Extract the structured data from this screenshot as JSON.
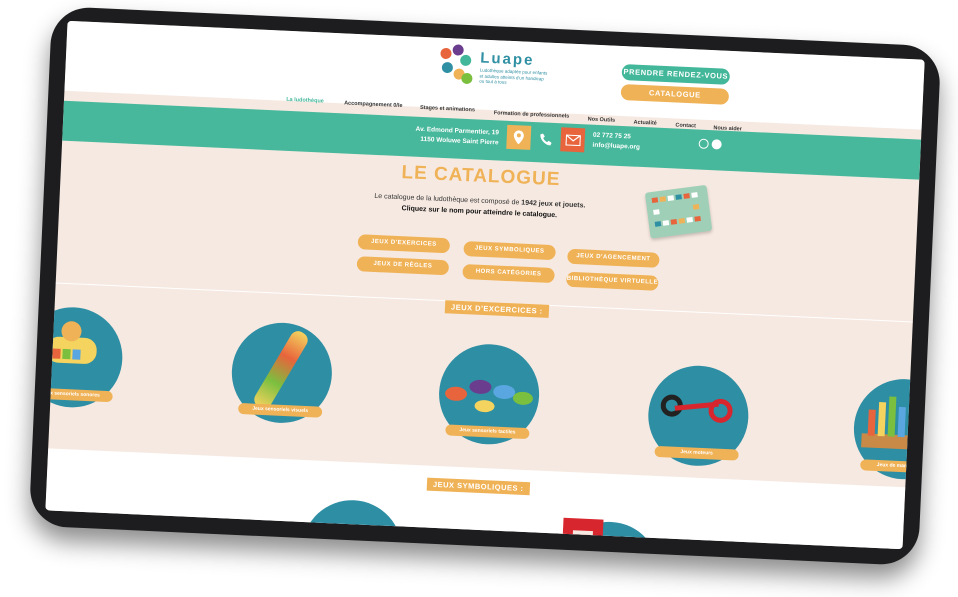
{
  "brand": {
    "name": "Luape",
    "tagline": "Ludothèque adaptée pour enfants et adultes atteints d'un handicap ou tout à tous"
  },
  "header": {
    "cta_appointment": "PRENDRE RENDEZ-VOUS",
    "cta_catalogue": "CATALOGUE"
  },
  "nav": {
    "items": [
      {
        "label": "La ludothèque",
        "active": true
      },
      {
        "label": "Accompagnement 0/le"
      },
      {
        "label": "Stages et animations"
      },
      {
        "label": "Formation de professionnels"
      },
      {
        "label": "Nos Outils"
      },
      {
        "label": "Actualité"
      },
      {
        "label": "Contact"
      },
      {
        "label": "Nous aider"
      }
    ]
  },
  "contact": {
    "address_line1": "Av. Edmond Parmentier, 19",
    "address_line2": "1150 Woluwe Saint Pierre",
    "phone": "02 772 75 25",
    "email": "info@luape.org",
    "icons": [
      "location-pin-icon",
      "phone-icon",
      "mail-icon",
      "instagram-icon",
      "facebook-icon"
    ]
  },
  "catalogue": {
    "title": "LE CATALOGUE",
    "intro_prefix": "Le catalogue de la ludothèque est composé de ",
    "intro_count": "1942 jeux et jouets.",
    "intro_line2": "Cliquez sur le nom pour atteindre le catalogue.",
    "buttons": [
      "JEUX D'EXERCICES",
      "JEUX SYMBOLIQUES",
      "JEUX D'AGENCEMENT",
      "JEUX DE RÈGLES",
      "HORS CATÉGORIES",
      "BIBLIOTHÈQUE VIRTUELLE"
    ]
  },
  "sections": {
    "exercices_label": "JEUX D'EXCERCICES :",
    "exercices_items": [
      "Jeux sensoriels sonores",
      "Jeux sensoriels visuels",
      "Jeux sensoriels tactiles",
      "Jeux moteurs",
      "Jeux de manipulation"
    ],
    "symboliques_label": "JEUX SYMBOLIQUES :"
  },
  "colors": {
    "teal": "#47b89b",
    "orange": "#f0b257",
    "red": "#e8643c",
    "circle_blue": "#2d8ea4",
    "background": "#f6e9e1"
  }
}
